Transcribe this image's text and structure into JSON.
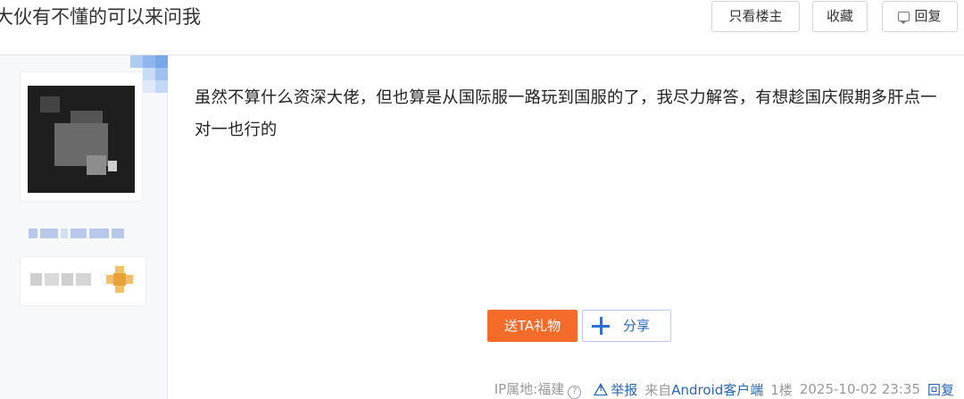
{
  "header": {
    "title": "大伙有不懂的可以来问我",
    "only_op_label": "只看楼主",
    "collect_label": "收藏",
    "reply_label": "回复"
  },
  "post": {
    "content": "虽然不算什么资深大佬，但也算是从国际服一路玩到国服的了，我尽力解答，有想趁国庆假期多肝点一对一也行的",
    "gift_label": "送TA礼物",
    "share_label": "分享"
  },
  "footer": {
    "ip_location": "IP属地:福建",
    "report_label": "举报",
    "from_prefix": "来自",
    "client": "Android客户端",
    "floor": "1楼",
    "timestamp": "2025-10-02 23:35",
    "reply_label": "回复"
  },
  "colors": {
    "accent_blue": "#2d64b3",
    "gift_orange": "#f56c2a",
    "border": "#d5d5d5"
  },
  "icons": [
    "reply-icon",
    "plus-icon",
    "help-icon",
    "warning-icon"
  ]
}
